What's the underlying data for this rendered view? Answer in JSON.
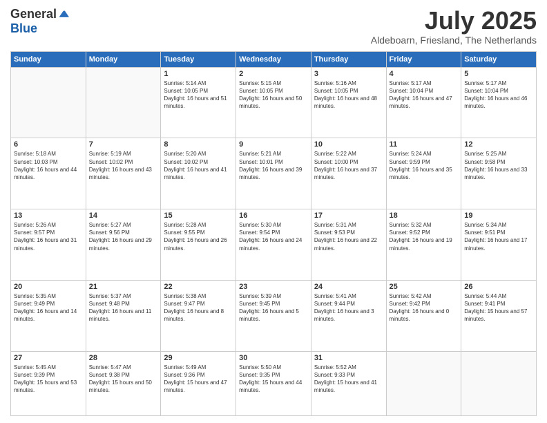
{
  "logo": {
    "general": "General",
    "blue": "Blue"
  },
  "title": "July 2025",
  "location": "Aldeboarn, Friesland, The Netherlands",
  "days_of_week": [
    "Sunday",
    "Monday",
    "Tuesday",
    "Wednesday",
    "Thursday",
    "Friday",
    "Saturday"
  ],
  "weeks": [
    [
      {
        "day": "",
        "info": ""
      },
      {
        "day": "",
        "info": ""
      },
      {
        "day": "1",
        "info": "Sunrise: 5:14 AM\nSunset: 10:05 PM\nDaylight: 16 hours and 51 minutes."
      },
      {
        "day": "2",
        "info": "Sunrise: 5:15 AM\nSunset: 10:05 PM\nDaylight: 16 hours and 50 minutes."
      },
      {
        "day": "3",
        "info": "Sunrise: 5:16 AM\nSunset: 10:05 PM\nDaylight: 16 hours and 48 minutes."
      },
      {
        "day": "4",
        "info": "Sunrise: 5:17 AM\nSunset: 10:04 PM\nDaylight: 16 hours and 47 minutes."
      },
      {
        "day": "5",
        "info": "Sunrise: 5:17 AM\nSunset: 10:04 PM\nDaylight: 16 hours and 46 minutes."
      }
    ],
    [
      {
        "day": "6",
        "info": "Sunrise: 5:18 AM\nSunset: 10:03 PM\nDaylight: 16 hours and 44 minutes."
      },
      {
        "day": "7",
        "info": "Sunrise: 5:19 AM\nSunset: 10:02 PM\nDaylight: 16 hours and 43 minutes."
      },
      {
        "day": "8",
        "info": "Sunrise: 5:20 AM\nSunset: 10:02 PM\nDaylight: 16 hours and 41 minutes."
      },
      {
        "day": "9",
        "info": "Sunrise: 5:21 AM\nSunset: 10:01 PM\nDaylight: 16 hours and 39 minutes."
      },
      {
        "day": "10",
        "info": "Sunrise: 5:22 AM\nSunset: 10:00 PM\nDaylight: 16 hours and 37 minutes."
      },
      {
        "day": "11",
        "info": "Sunrise: 5:24 AM\nSunset: 9:59 PM\nDaylight: 16 hours and 35 minutes."
      },
      {
        "day": "12",
        "info": "Sunrise: 5:25 AM\nSunset: 9:58 PM\nDaylight: 16 hours and 33 minutes."
      }
    ],
    [
      {
        "day": "13",
        "info": "Sunrise: 5:26 AM\nSunset: 9:57 PM\nDaylight: 16 hours and 31 minutes."
      },
      {
        "day": "14",
        "info": "Sunrise: 5:27 AM\nSunset: 9:56 PM\nDaylight: 16 hours and 29 minutes."
      },
      {
        "day": "15",
        "info": "Sunrise: 5:28 AM\nSunset: 9:55 PM\nDaylight: 16 hours and 26 minutes."
      },
      {
        "day": "16",
        "info": "Sunrise: 5:30 AM\nSunset: 9:54 PM\nDaylight: 16 hours and 24 minutes."
      },
      {
        "day": "17",
        "info": "Sunrise: 5:31 AM\nSunset: 9:53 PM\nDaylight: 16 hours and 22 minutes."
      },
      {
        "day": "18",
        "info": "Sunrise: 5:32 AM\nSunset: 9:52 PM\nDaylight: 16 hours and 19 minutes."
      },
      {
        "day": "19",
        "info": "Sunrise: 5:34 AM\nSunset: 9:51 PM\nDaylight: 16 hours and 17 minutes."
      }
    ],
    [
      {
        "day": "20",
        "info": "Sunrise: 5:35 AM\nSunset: 9:49 PM\nDaylight: 16 hours and 14 minutes."
      },
      {
        "day": "21",
        "info": "Sunrise: 5:37 AM\nSunset: 9:48 PM\nDaylight: 16 hours and 11 minutes."
      },
      {
        "day": "22",
        "info": "Sunrise: 5:38 AM\nSunset: 9:47 PM\nDaylight: 16 hours and 8 minutes."
      },
      {
        "day": "23",
        "info": "Sunrise: 5:39 AM\nSunset: 9:45 PM\nDaylight: 16 hours and 5 minutes."
      },
      {
        "day": "24",
        "info": "Sunrise: 5:41 AM\nSunset: 9:44 PM\nDaylight: 16 hours and 3 minutes."
      },
      {
        "day": "25",
        "info": "Sunrise: 5:42 AM\nSunset: 9:42 PM\nDaylight: 16 hours and 0 minutes."
      },
      {
        "day": "26",
        "info": "Sunrise: 5:44 AM\nSunset: 9:41 PM\nDaylight: 15 hours and 57 minutes."
      }
    ],
    [
      {
        "day": "27",
        "info": "Sunrise: 5:45 AM\nSunset: 9:39 PM\nDaylight: 15 hours and 53 minutes."
      },
      {
        "day": "28",
        "info": "Sunrise: 5:47 AM\nSunset: 9:38 PM\nDaylight: 15 hours and 50 minutes."
      },
      {
        "day": "29",
        "info": "Sunrise: 5:49 AM\nSunset: 9:36 PM\nDaylight: 15 hours and 47 minutes."
      },
      {
        "day": "30",
        "info": "Sunrise: 5:50 AM\nSunset: 9:35 PM\nDaylight: 15 hours and 44 minutes."
      },
      {
        "day": "31",
        "info": "Sunrise: 5:52 AM\nSunset: 9:33 PM\nDaylight: 15 hours and 41 minutes."
      },
      {
        "day": "",
        "info": ""
      },
      {
        "day": "",
        "info": ""
      }
    ]
  ]
}
